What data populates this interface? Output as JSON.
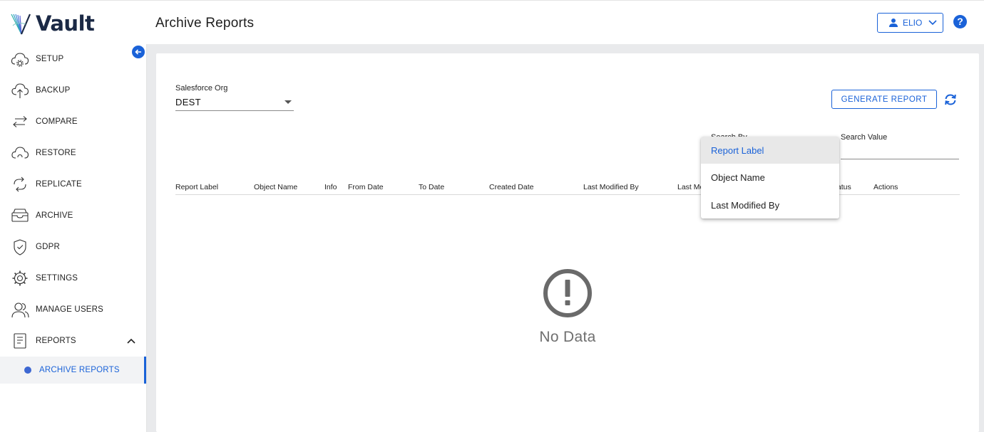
{
  "app": {
    "name": "Vault"
  },
  "header": {
    "title": "Archive Reports",
    "user_label": "ELIO",
    "help_symbol": "?"
  },
  "colors": {
    "accent": "#1a62d8",
    "brand_dark": "#1b2945",
    "muted_text": "#6f6f6f"
  },
  "sidebar": {
    "items": [
      {
        "label": "SETUP",
        "icon": "cloud-gear-icon"
      },
      {
        "label": "BACKUP",
        "icon": "cloud-upload-icon"
      },
      {
        "label": "COMPARE",
        "icon": "compare-arrows-icon"
      },
      {
        "label": "RESTORE",
        "icon": "cloud-restore-icon"
      },
      {
        "label": "REPLICATE",
        "icon": "replicate-icon"
      },
      {
        "label": "ARCHIVE",
        "icon": "archive-tray-icon"
      },
      {
        "label": "GDPR",
        "icon": "shield-check-icon"
      },
      {
        "label": "SETTINGS",
        "icon": "gear-icon"
      },
      {
        "label": "MANAGE USERS",
        "icon": "users-icon"
      },
      {
        "label": "REPORTS",
        "icon": "report-document-icon",
        "expanded": true
      }
    ],
    "sub_items": [
      {
        "label": "ARCHIVE REPORTS",
        "active": true
      }
    ]
  },
  "filters": {
    "org_label": "Salesforce Org",
    "org_value": "DEST",
    "generate_button": "GENERATE REPORT",
    "search_by_label": "Search By",
    "search_value_label": "Search Value",
    "search_value": ""
  },
  "table": {
    "columns": [
      "Report Label",
      "Object Name",
      "Info",
      "From Date",
      "To Date",
      "Created Date",
      "Last Modified By",
      "Last Mo",
      "Status",
      "Actions"
    ],
    "empty_text": "No Data"
  },
  "search_by_menu": {
    "options": [
      "Report Label",
      "Object Name",
      "Last Modified By"
    ],
    "selected": "Report Label"
  }
}
